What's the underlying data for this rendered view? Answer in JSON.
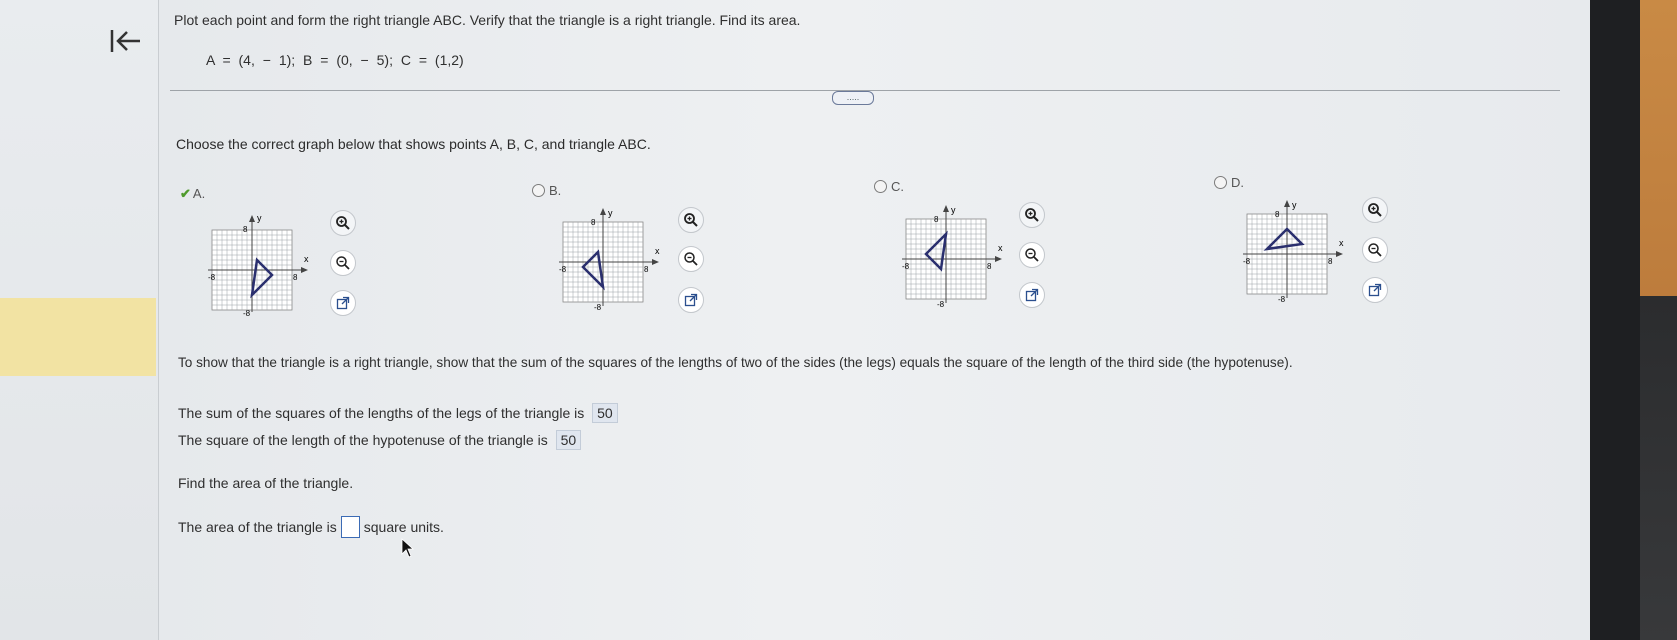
{
  "question": {
    "text": "Plot each point and form the right triangle ABC. Verify that the triangle is a right triangle. Find its area.",
    "points": "A = (4, − 1);   B = (0, − 5);   C = (1,2)"
  },
  "more_button": {
    "label": "....."
  },
  "prompt": "Choose the correct graph below that shows points A, B, C, and triangle ABC.",
  "options": [
    {
      "label": "A.",
      "selected": true
    },
    {
      "label": "B.",
      "selected": false
    },
    {
      "label": "C.",
      "selected": false
    },
    {
      "label": "D.",
      "selected": false
    }
  ],
  "graph_labels": {
    "y": "y",
    "x": "x",
    "pos": "8",
    "neg": "-8"
  },
  "explanation": "To show that the triangle is a right triangle, show that the sum of the squares of the lengths of two of the sides (the legs) equals the square of the length of the third side (the hypotenuse).",
  "legs_sentence": {
    "text": "The sum of the squares of the lengths of the legs of the triangle is",
    "value": "50"
  },
  "hyp_sentence": {
    "text": "The square of the length of the hypotenuse of the triangle is",
    "value": "50"
  },
  "find_area": "Find the area of the triangle.",
  "area_sentence": {
    "prefix": "The area of the triangle is",
    "suffix": "square units."
  },
  "colors": {
    "accent": "#2a2f6e",
    "check": "#4f9a2c",
    "answer_bg": "#e0e6ef"
  },
  "icons": [
    "back-arrow-icon",
    "zoom-in-icon",
    "zoom-out-icon",
    "external-link-icon",
    "check-icon",
    "cursor-icon"
  ]
}
